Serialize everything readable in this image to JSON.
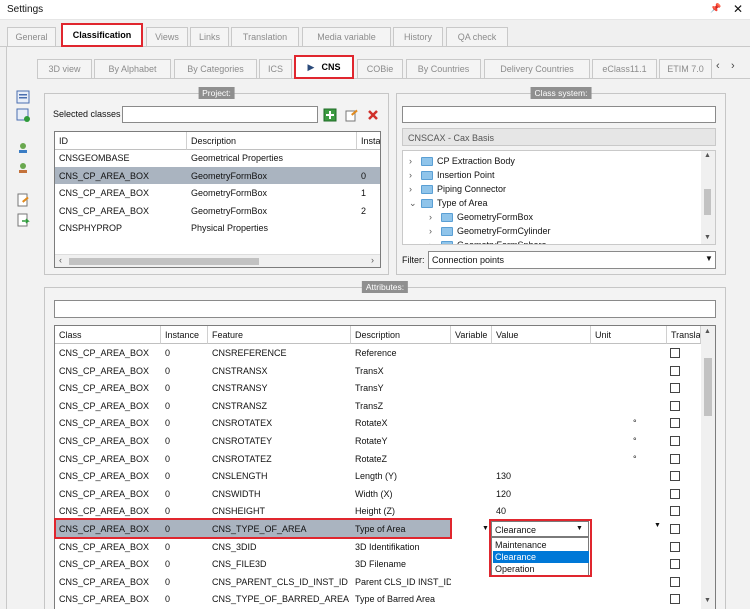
{
  "window": {
    "title": "Settings",
    "pin_glyph": "📌",
    "close_glyph": "✕"
  },
  "main_tabs": [
    {
      "label": "General"
    },
    {
      "label": "Classification"
    },
    {
      "label": "Views"
    },
    {
      "label": "Links"
    },
    {
      "label": "Translation"
    },
    {
      "label": "Media variable"
    },
    {
      "label": "History"
    },
    {
      "label": "QA check"
    }
  ],
  "sub_tabs": [
    {
      "label": "3D view"
    },
    {
      "label": "By Alphabet"
    },
    {
      "label": "By Categories"
    },
    {
      "label": "ICS"
    },
    {
      "label": "CNS"
    },
    {
      "label": "COBie"
    },
    {
      "label": "By Countries"
    },
    {
      "label": "Delivery Countries"
    },
    {
      "label": "eClass11.1"
    },
    {
      "label": "ETIM 7.0"
    }
  ],
  "project": {
    "title": "Project:",
    "selected_classes_label": "Selected classes",
    "columns": [
      "ID",
      "Description",
      "Insta"
    ],
    "rows": [
      [
        "CNSGEOMBASE",
        "Geometrical Properties",
        ""
      ],
      [
        "CNS_CP_AREA_BOX",
        "GeometryFormBox",
        "0"
      ],
      [
        "CNS_CP_AREA_BOX",
        "GeometryFormBox",
        "1"
      ],
      [
        "CNS_CP_AREA_BOX",
        "GeometryFormBox",
        "2"
      ],
      [
        "CNSPHYPROP",
        "Physical Properties",
        ""
      ]
    ]
  },
  "class_system": {
    "title": "Class system:",
    "system_name": "CNSCAX - Cax Basis",
    "tree": [
      {
        "label": "CP Extraction Body",
        "arrow": "›"
      },
      {
        "label": "Insertion Point",
        "arrow": "›"
      },
      {
        "label": "Piping Connector",
        "arrow": "›"
      },
      {
        "label": "Type of Area",
        "arrow": "⌄"
      },
      {
        "label": "GeometryFormBox",
        "arrow": "›"
      },
      {
        "label": "GeometryFormCylinder",
        "arrow": "›"
      },
      {
        "label": "GeometryFormSphere",
        "arrow": "›"
      }
    ],
    "filter_label": "Filter:",
    "filter_value": "Connection points"
  },
  "attributes": {
    "title": "Attributes:",
    "columns": [
      "Class",
      "Instance",
      "Feature",
      "Description",
      "Variable",
      "Value",
      "Unit",
      "Translat"
    ],
    "rows": [
      {
        "cls": "CNS_CP_AREA_BOX",
        "inst": "0",
        "feat": "CNSREFERENCE",
        "desc": "Reference",
        "value": "",
        "unit": ""
      },
      {
        "cls": "CNS_CP_AREA_BOX",
        "inst": "0",
        "feat": "CNSTRANSX",
        "desc": "TransX",
        "value": "",
        "unit": ""
      },
      {
        "cls": "CNS_CP_AREA_BOX",
        "inst": "0",
        "feat": "CNSTRANSY",
        "desc": "TransY",
        "value": "",
        "unit": ""
      },
      {
        "cls": "CNS_CP_AREA_BOX",
        "inst": "0",
        "feat": "CNSTRANSZ",
        "desc": "TransZ",
        "value": "",
        "unit": ""
      },
      {
        "cls": "CNS_CP_AREA_BOX",
        "inst": "0",
        "feat": "CNSROTATEX",
        "desc": "RotateX",
        "value": "",
        "unit": "°"
      },
      {
        "cls": "CNS_CP_AREA_BOX",
        "inst": "0",
        "feat": "CNSROTATEY",
        "desc": "RotateY",
        "value": "",
        "unit": "°"
      },
      {
        "cls": "CNS_CP_AREA_BOX",
        "inst": "0",
        "feat": "CNSROTATEZ",
        "desc": "RotateZ",
        "value": "",
        "unit": "°"
      },
      {
        "cls": "CNS_CP_AREA_BOX",
        "inst": "0",
        "feat": "CNSLENGTH",
        "desc": "Length (Y)",
        "value": "130",
        "unit": ""
      },
      {
        "cls": "CNS_CP_AREA_BOX",
        "inst": "0",
        "feat": "CNSWIDTH",
        "desc": "Width (X)",
        "value": "120",
        "unit": ""
      },
      {
        "cls": "CNS_CP_AREA_BOX",
        "inst": "0",
        "feat": "CNSHEIGHT",
        "desc": "Height (Z)",
        "value": "40",
        "unit": ""
      },
      {
        "cls": "CNS_CP_AREA_BOX",
        "inst": "0",
        "feat": "CNS_TYPE_OF_AREA",
        "desc": "Type of Area",
        "value": "Clearance",
        "unit": ""
      },
      {
        "cls": "CNS_CP_AREA_BOX",
        "inst": "0",
        "feat": "CNS_3DID",
        "desc": "3D Identifikation",
        "value": "",
        "unit": ""
      },
      {
        "cls": "CNS_CP_AREA_BOX",
        "inst": "0",
        "feat": "CNS_FILE3D",
        "desc": "3D Filename",
        "value": "",
        "unit": ""
      },
      {
        "cls": "CNS_CP_AREA_BOX",
        "inst": "0",
        "feat": "CNS_PARENT_CLS_ID_INST_ID",
        "desc": "Parent CLS_ID INST_ID",
        "value": "",
        "unit": ""
      },
      {
        "cls": "CNS_CP_AREA_BOX",
        "inst": "0",
        "feat": "CNS_TYPE_OF_BARRED_AREA",
        "desc": "Type of Barred Area",
        "value": "",
        "unit": ""
      }
    ],
    "dropdown_options": [
      "Maintenance",
      "Clearance",
      "Operation"
    ]
  },
  "colors": {
    "highlight": "#e0262e",
    "selection": "#aab4c0",
    "dropdown_selected": "#0078d7"
  }
}
